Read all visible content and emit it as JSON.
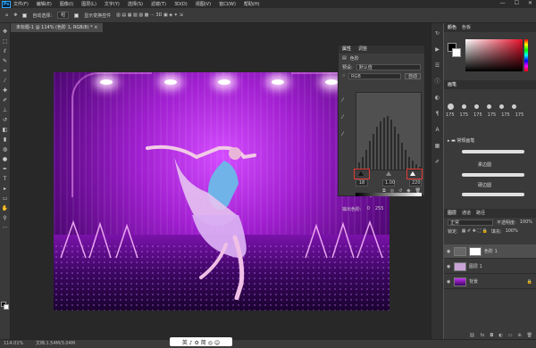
{
  "menu": {
    "items": [
      "文件(F)",
      "编辑(E)",
      "图像(I)",
      "图层(L)",
      "文字(Y)",
      "选择(S)",
      "滤镜(T)",
      "3D(D)",
      "视图(V)",
      "窗口(W)",
      "帮助(H)"
    ],
    "logo": "Ps",
    "window_controls": [
      "—",
      "☐",
      "✕"
    ]
  },
  "options": {
    "auto_select_label": "自动选择:",
    "target_value": "组",
    "transform_label": "显示变换控件"
  },
  "document": {
    "tab_title": "未标题-1 @ 114% (色阶 1, RGB/8) * ×"
  },
  "properties": {
    "tab_properties": "属性",
    "tab_adjust": "调整",
    "panel_title": "色阶",
    "preset_label": "预设:",
    "preset_value": "默认值",
    "channel_value": "RGB",
    "auto_button": "自动",
    "input_black": "18",
    "input_gamma": "1.00",
    "input_white": "220",
    "output_label": "输出色阶:",
    "output_black": "0",
    "output_white": "255"
  },
  "color_panel": {
    "tab_color": "颜色",
    "tab_swatches": "色板"
  },
  "brush_panel": {
    "tab_brushes": "画笔",
    "sizes": [
      "175",
      "175",
      "175",
      "175",
      "175",
      "175",
      "175"
    ],
    "folder": "常规画笔",
    "brush_names": [
      "柔边圆",
      "硬边圆"
    ]
  },
  "layers_panel": {
    "tab_layers": "图层",
    "tab_channels": "通道",
    "tab_paths": "路径",
    "blend_mode": "正常",
    "opacity_label": "不透明度:",
    "opacity_value": "100%",
    "lock_label": "锁定:",
    "fill_label": "填充:",
    "fill_value": "100%",
    "layers": [
      "色阶 1",
      "图层 1",
      "背景"
    ]
  },
  "status": {
    "zoom": "114.01%",
    "doc_size": "文档:1.54M/3.04M"
  },
  "ime_bar": {
    "text": "英 ♪ ⚙ 简 ◎ ☺"
  }
}
